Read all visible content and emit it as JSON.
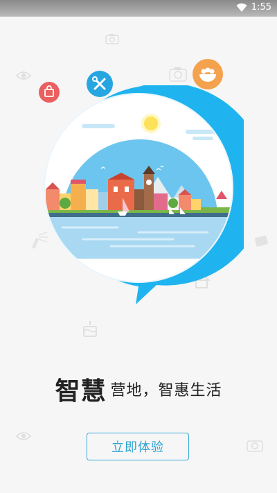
{
  "status_bar": {
    "time": "1:55",
    "wifi_icon": "wifi-icon"
  },
  "headline": {
    "emphasis": "智慧",
    "rest": "营地，智惠生活"
  },
  "start_button": {
    "label": "立即体验"
  },
  "icons": [
    "camera-icon",
    "eye-icon",
    "bag-icon",
    "tools-icon",
    "salad-bowl-icon",
    "tshirt-icon",
    "lighthouse-icon",
    "home-icon",
    "cake-icon",
    "picture-icon"
  ],
  "colors": {
    "accent": "#2ea4d4",
    "ring": "#1fb4ef",
    "sky": "#6cc5ee",
    "water": "#a9d8f2"
  }
}
